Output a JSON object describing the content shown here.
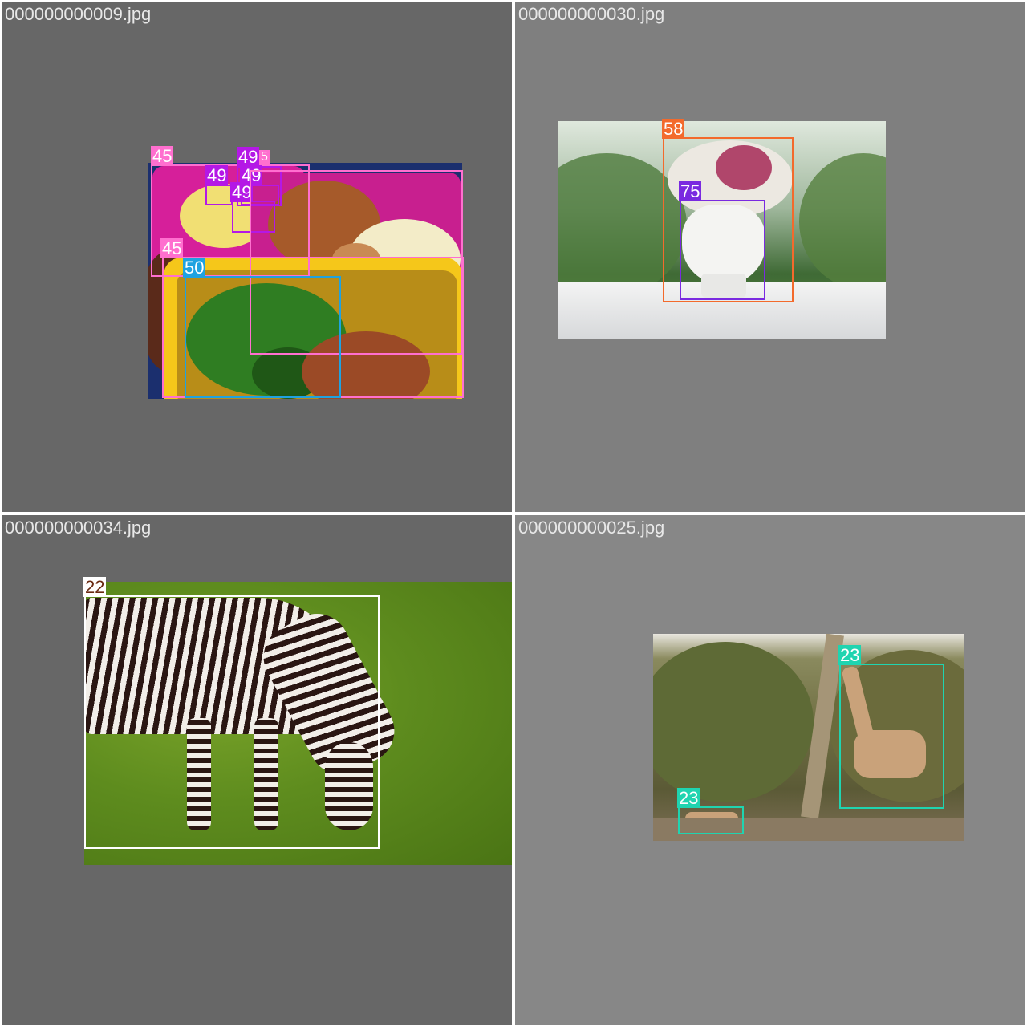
{
  "tiles": [
    {
      "filename": "000000000009.jpg",
      "labels": [
        "45",
        "49",
        "5",
        "49",
        "49",
        "49",
        "45",
        "50"
      ]
    },
    {
      "filename": "000000000030.jpg",
      "labels": [
        "58",
        "75"
      ]
    },
    {
      "filename": "000000000034.jpg",
      "labels": [
        "22"
      ]
    },
    {
      "filename": "000000000025.jpg",
      "labels": [
        "23",
        "23"
      ]
    }
  ],
  "colors": {
    "class_45": "#ff6fcf",
    "class_49": "#b418e6",
    "class_50": "#1fa2e0",
    "class_58": "#f36a2c",
    "class_75": "#7a2ae0",
    "class_22": "#ffffff",
    "class_23": "#1fd4b0"
  }
}
